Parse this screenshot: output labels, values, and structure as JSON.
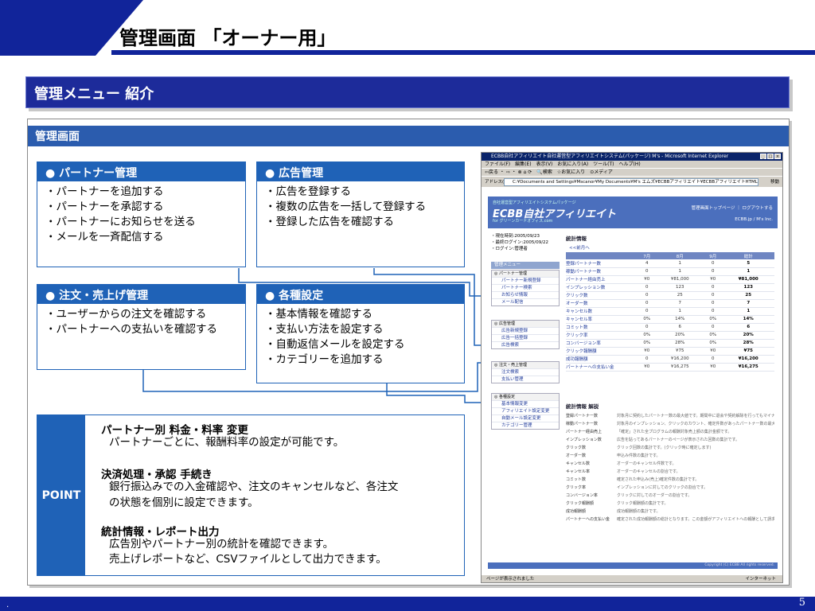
{
  "slide": {
    "title": "管理画面 「オーナー用」",
    "subtitle": "管理メニュー 紹介",
    "page_number": "5",
    "footer_dot": "."
  },
  "panel": {
    "title": "管理画面"
  },
  "cards": {
    "partner": {
      "title": "● パートナー管理",
      "items": [
        "・パートナーを追加する",
        "・パートナーを承認する",
        "・パートナーにお知らせを送る",
        "・メールを一斉配信する"
      ]
    },
    "ads": {
      "title": "● 広告管理",
      "items": [
        "・広告を登録する",
        "・複数の広告を一括して登録する",
        "・登録した広告を確認する"
      ]
    },
    "orders": {
      "title": "● 注文・売上げ管理",
      "items": [
        "・ユーザーからの注文を確認する",
        "・パートナーへの支払いを確認する"
      ]
    },
    "settings": {
      "title": "● 各種設定",
      "items": [
        "・基本情報を確認する",
        "・支払い方法を設定する",
        "・自動返信メールを設定する",
        "・カテゴリーを追加する"
      ]
    }
  },
  "point": {
    "label": "POINT",
    "items": [
      {
        "title": "パートナー別 料金・料率 変更",
        "desc": [
          "パートナーごとに、報酬料率の設定が可能です。"
        ]
      },
      {
        "title": "決済処理・承認 手続き",
        "desc": [
          "銀行振込みでの入金確認や、注文のキャンセルなど、各注文",
          "の状態を個別に設定できます。"
        ]
      },
      {
        "title": "統計情報・レポート出力",
        "desc": [
          "広告別やパートナー別の統計を確認できます。",
          "売上げレポートなど、CSVファイルとして出力できます。"
        ]
      }
    ]
  },
  "browser": {
    "title": "ECBB自社アフィリエイト自社運営型アフィリエイトシステム(パッケージ) M's - Microsoft Internet Explorer",
    "menu": "ファイル(F)　編集(E)　表示(V)　お気に入り(A)　ツール(T)　ヘルプ(H)",
    "toolbar": "⇦戻る ・ ⇨ ・ ⊗ ⌂ ⟳　🔍検索　☆お気に入り　⊙メディア",
    "address_label": "アドレス(D)",
    "address": "C:¥Documents and Settings¥Mscanor¥My Documents¥M's エムズ¥ECBBアフィリエイト¥ECBBアフィリエイトHTMLデータ¥A",
    "go": "移動",
    "banner": {
      "tag": "自社運営型アフィリエイトシステムパッケージ",
      "name": "ECBB自社アフィリエイト",
      "sub": "for グリーンカードオフィス.com",
      "links": "管理画面トップページ ｜ ログアウトする",
      "brand": "ECBB.jp / M's Inc."
    },
    "info": [
      "・現在時刻:2005/09/23",
      "・最終ログイン:2005/09/22",
      "・ログイン:管理者"
    ],
    "menu_header": "管理メニュー",
    "groups": [
      {
        "head": "◎ パートナー管理",
        "items": [
          "パートナー新規登録",
          "パートナー検索",
          "お知らせ情報",
          "メール配信"
        ]
      },
      {
        "head": "◎ 広告管理",
        "items": [
          "広告新規登録",
          "広告一括登録",
          "広告検索"
        ]
      },
      {
        "head": "◎ 注文・売上管理",
        "items": [
          "注文検索",
          "支払い管理"
        ]
      },
      {
        "head": "◎ 各種設定",
        "items": [
          "基本情報変更",
          "アフィリエイト設定変更",
          "自動メール設定変更",
          "カテゴリー管理"
        ]
      }
    ],
    "stats_title": "統計情報",
    "back_link": "<<前月へ",
    "table_headers": [
      "",
      "7月",
      "8月",
      "9月",
      "総計"
    ],
    "table_rows": [
      [
        "登録パートナー数",
        "4",
        "1",
        "0",
        "5"
      ],
      [
        "稼動パートナー数",
        "0",
        "1",
        "0",
        "1"
      ],
      [
        "パートナー経由売上",
        "¥0",
        "¥81,000",
        "¥0",
        "¥81,000"
      ],
      [
        "インプレッション数",
        "0",
        "123",
        "0",
        "123"
      ],
      [
        "クリック数",
        "0",
        "25",
        "0",
        "25"
      ],
      [
        "オーダー数",
        "0",
        "7",
        "0",
        "7"
      ],
      [
        "キャンセル数",
        "0",
        "1",
        "0",
        "1"
      ],
      [
        "キャンセル率",
        "0%",
        "14%",
        "0%",
        "14%"
      ],
      [
        "コミット数",
        "0",
        "6",
        "0",
        "6"
      ],
      [
        "クリック率",
        "0%",
        "20%",
        "0%",
        "20%"
      ],
      [
        "コンバージョン率",
        "0%",
        "28%",
        "0%",
        "28%"
      ],
      [
        "クリック報酬額",
        "¥0",
        "¥75",
        "¥0",
        "¥75"
      ],
      [
        "成功報酬額",
        "0",
        "¥16,200",
        "0",
        "¥16,200"
      ],
      [
        "パートナーへの支払い金",
        "¥0",
        "¥16,275",
        "¥0",
        "¥16,275"
      ]
    ],
    "explain_title": "統計情報 解説",
    "explain_rows": [
      [
        "登録パートナー数",
        "対象月に契約したパートナー数の最大値です。期間中に退会や契約解除を行ってもマイナスカウントされません。"
      ],
      [
        "",
        ""
      ],
      [
        "稼動パートナー数",
        "対象月のインプレッション、クリックのカウント、確定件数があったパートナー数の最大値です。"
      ],
      [
        "",
        ""
      ],
      [
        "パートナー経由売上",
        "「確定」された全プログラムの報酬対象売上額の集計金額です。"
      ],
      [
        "インプレッション数",
        "広告を貼ってあるパートナーのページが表示された回数の集計です。"
      ],
      [
        "クリック数",
        "クリック回数の集計です。(クリック時に確定します)"
      ],
      [
        "オーダー数",
        "申込み件数の集計です。"
      ],
      [
        "キャンセル数",
        "オーダーのキャンセル件数です。"
      ],
      [
        "キャンセル率",
        "オーダーのキャンセルの割合です。"
      ],
      [
        "コミット数",
        "確定された申込み(売上)確定件数の集計です。"
      ],
      [
        "クリック率",
        "インプレッションに対してのクリックの割合です。"
      ],
      [
        "コンバージョン率",
        "クリックに対してのオーダーの割合です。"
      ],
      [
        "クリック報酬額",
        "クリック報酬額の集計です。"
      ],
      [
        "成功報酬額",
        "成功報酬額の集計です。"
      ],
      [
        "パートナーへの支払い金",
        "確定された成功報酬額の総計となります。この金額がアフィリエイトへの報酬として請求されます。"
      ]
    ],
    "copyright": "Copyright (C) ECBB All rights reserved.",
    "status_left": "ページが表示されました",
    "status_right": "インターネット"
  }
}
